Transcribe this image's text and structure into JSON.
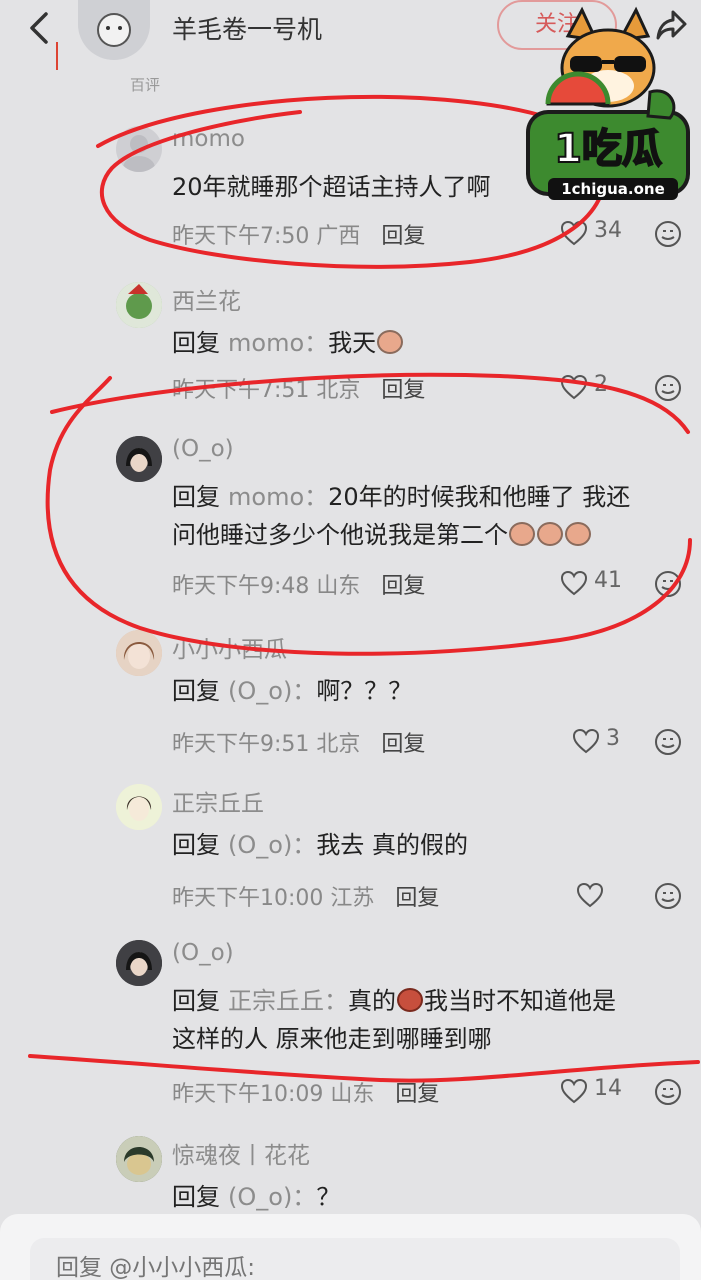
{
  "header": {
    "title": "羊毛卷一号机",
    "follow_label": "关注",
    "sub_tab": "百评"
  },
  "watermark": {
    "brand": "1吃瓜",
    "url": "1chigua.one"
  },
  "comments": [
    {
      "name": "momo",
      "reply_prefix": "",
      "reply_target": "",
      "text_lines": [
        "20年就睡那个超话主持人了啊"
      ],
      "time": "昨天下午7:50",
      "location": "广西",
      "reply_label": "回复",
      "likes": "34"
    },
    {
      "name": "西兰花",
      "reply_prefix": "回复",
      "reply_target": "momo：",
      "text_lines": [
        "我天"
      ],
      "time": "昨天下午7:51",
      "location": "北京",
      "reply_label": "回复",
      "likes": "2"
    },
    {
      "name": "(O_o)",
      "reply_prefix": "回复",
      "reply_target": "momo：",
      "text_lines": [
        "20年的时候我和他睡了 我还",
        "问他睡过多少个他说我是第二个"
      ],
      "time": "昨天下午9:48",
      "location": "山东",
      "reply_label": "回复",
      "likes": "41"
    },
    {
      "name": "小小小西瓜",
      "reply_prefix": "回复",
      "reply_target": "(O_o)：",
      "text_lines": [
        "啊？？？"
      ],
      "time": "昨天下午9:51",
      "location": "北京",
      "reply_label": "回复",
      "likes": "3"
    },
    {
      "name": "正宗丘丘",
      "reply_prefix": "回复",
      "reply_target": "(O_o)：",
      "text_lines": [
        "我去 真的假的"
      ],
      "time": "昨天下午10:00",
      "location": "江苏",
      "reply_label": "回复",
      "likes": ""
    },
    {
      "name": "(O_o)",
      "reply_prefix": "回复",
      "reply_target": "正宗丘丘：",
      "text_lines": [
        "真的",
        "我当时不知道他是",
        "这样的人 原来他走到哪睡到哪"
      ],
      "time": "昨天下午10:09",
      "location": "山东",
      "reply_label": "回复",
      "likes": "14"
    },
    {
      "name": "惊魂夜丨花花",
      "reply_prefix": "回复",
      "reply_target": "(O_o)：",
      "text_lines": [
        "？"
      ]
    }
  ],
  "input": {
    "placeholder": "回复 @小小小西瓜:"
  },
  "colors": {
    "background": "#e3e3e5",
    "scribble": "#e8262a",
    "follow_border": "#e29a9a"
  }
}
